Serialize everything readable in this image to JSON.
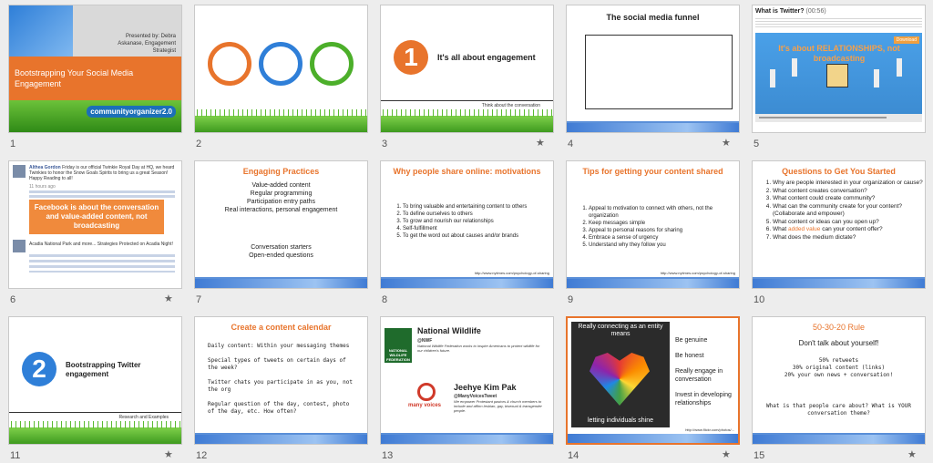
{
  "slides": [
    {
      "num": "1",
      "presenter": "Presented by: Debra Askanase, Engagement Strategist",
      "title": "Bootstrapping Your Social Media Engagement",
      "logo": "communityorganizer2.0"
    },
    {
      "num": "2"
    },
    {
      "num": "3",
      "circle_num": "1",
      "title": "It's all about engagement",
      "footer": "Think about the conversation",
      "star": "★"
    },
    {
      "num": "4",
      "title": "The social media funnel",
      "star": "★"
    },
    {
      "num": "5",
      "title": "What is Twitter?",
      "title_extra": "(00:56)",
      "overlay": "It's about RELATIONSHIPS, not broadcasting",
      "button": "Download"
    },
    {
      "num": "6",
      "post1_name": "Althea Gordon",
      "post1": "Friday is our official Twinkie Royal Day at HQ, we heard Twinkies to honor the Snow Goals Spirits to bring us a great Season! Happy Reading to all!",
      "post1_meta": "11 hours ago",
      "callout": "Facebook is about the conversation and value-added content, not broadcasting",
      "post2": "Acadia National Park and more... Strategies Protected on Acadia Night!",
      "star": "★"
    },
    {
      "num": "7",
      "title": "Engaging Practices",
      "lines": [
        "Value-added content",
        "Regular programming",
        "Participation entry paths",
        "Real interactions, personal engagement"
      ],
      "lines2": [
        "Conversation starters",
        "Open-ended questions"
      ]
    },
    {
      "num": "8",
      "title": "Why people share online: motivations",
      "items": [
        "To bring valuable and entertaining content to others",
        "To define ourselves to others",
        "To grow and nourish our relationships",
        "Self-fulfillment",
        "To get the word out about causes and/or brands"
      ],
      "source": "http://www.nytimes.com/psychology-of-sharing"
    },
    {
      "num": "9",
      "title": "Tips for getting your content shared",
      "items": [
        "Appeal to motivation to connect with others, not the organization",
        "Keep messages simple",
        "Appeal to personal reasons for sharing",
        "Embrace a sense of urgency",
        "Understand why they follow you"
      ],
      "source": "http://www.nytimes.com/psychology-of-sharing"
    },
    {
      "num": "10",
      "title": "Questions to Get You Started",
      "items": [
        "Why are people interested in your organization or cause?",
        "What content creates conversation?",
        "What content could create community?",
        "What can the community create for your content? (Collaborate and empower)",
        "What content or ideas can you open up?",
        "What added value can your content offer?",
        "What does the medium dictate?"
      ],
      "highlight": "added value"
    },
    {
      "num": "11",
      "circle_num": "2",
      "title": "Bootstrapping Twitter engagement",
      "footer": "Research and Examples",
      "star": "★"
    },
    {
      "num": "12",
      "title": "Create a content calendar",
      "paras": [
        "Daily content: Within your messaging themes",
        "Special types of tweets on certain days of the week?",
        "Twitter chats you participate in as you, not the org",
        "Regular question of the day, contest, photo of the day, etc. How often?"
      ]
    },
    {
      "num": "13",
      "org": "National Wildlife",
      "org_handle": "@NWF",
      "org_desc": "National Wildlife Federation works to inspire Americans to protect wildlife for our children's future.",
      "logo_text": "NATIONAL WILDLIFE FEDERATION",
      "person": "Jeehye Kim Pak",
      "person_handle": "@ManyVoicesTweet",
      "person_desc": "We empower Protestant pastors & church members to include and affirm lesbian, gay, bisexual & transgender people.",
      "logo2_text": "many voices"
    },
    {
      "num": "14",
      "img_top": "Really connecting as an entity means",
      "img_bottom": "letting individuals shine",
      "items": [
        "Be genuine",
        "Be honest",
        "Really engage in conversation",
        "Invest in developing relationships"
      ],
      "source": "http://www.flickr.com/photos/...",
      "star": "★"
    },
    {
      "num": "15",
      "title": "50-30-20 Rule",
      "subtitle": "Don't talk about yourself!",
      "lines": [
        "50% retweets",
        "30% original content (links)",
        "20% your own news + conversation!"
      ],
      "question": "What is that people care about? What is YOUR conversation theme?",
      "star": "★"
    }
  ],
  "colors": {
    "accent": "#e8742c",
    "blue": "#3f7bd4",
    "green": "#4caf2a"
  }
}
